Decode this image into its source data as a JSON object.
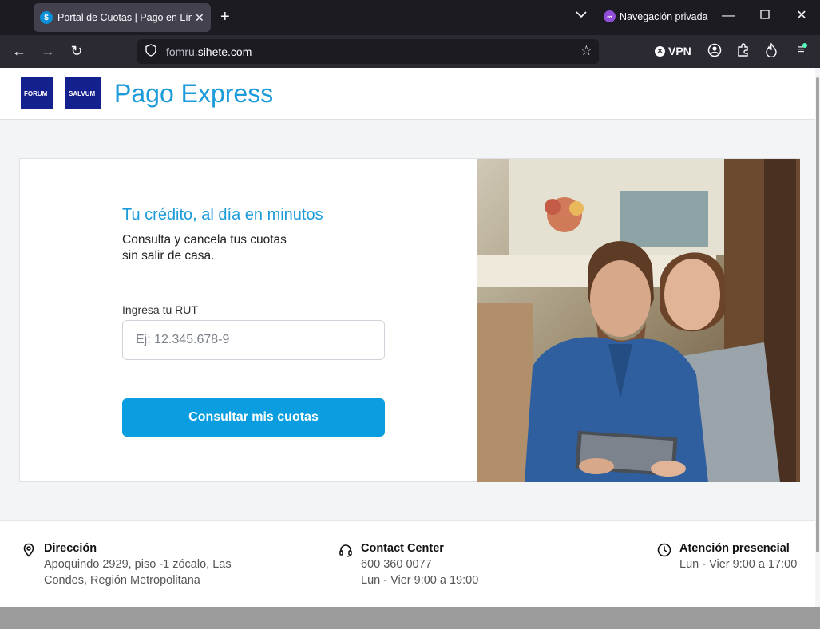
{
  "browser": {
    "tab_title": "Portal de Cuotas | Pago en Línea",
    "tab_favicon_letter": "$",
    "private_label": "Navegación privada",
    "url_prefix": "fomru.",
    "url_domain": "sihete.com",
    "vpn_label": "VPN"
  },
  "header": {
    "logo1": "FORUM",
    "logo2": "SALVUM",
    "title": "Pago Express"
  },
  "hero": {
    "heading": "Tu crédito, al día en minutos",
    "sub_line1": "Consulta y cancela tus cuotas",
    "sub_line2": "sin salir de casa.",
    "rut_label": "Ingresa tu RUT",
    "rut_placeholder": "Ej: 12.345.678-9",
    "rut_value": "",
    "submit_label": "Consultar mis cuotas"
  },
  "footer": {
    "address": {
      "title": "Dirección",
      "line1": "Apoquindo 2929, piso -1 zócalo, Las",
      "line2": "Condes, Región Metropolitana"
    },
    "contact": {
      "title": "Contact Center",
      "phone": "600 360 0077",
      "hours": "Lun - Vier 9:00 a 19:00"
    },
    "attention": {
      "title": "Atención presencial",
      "hours": "Lun - Vier 9:00 a 17:00"
    }
  },
  "colors": {
    "brand_blue": "#1b9bd9",
    "button_blue": "#0a9ee0",
    "logo_navy": "#15208f"
  }
}
